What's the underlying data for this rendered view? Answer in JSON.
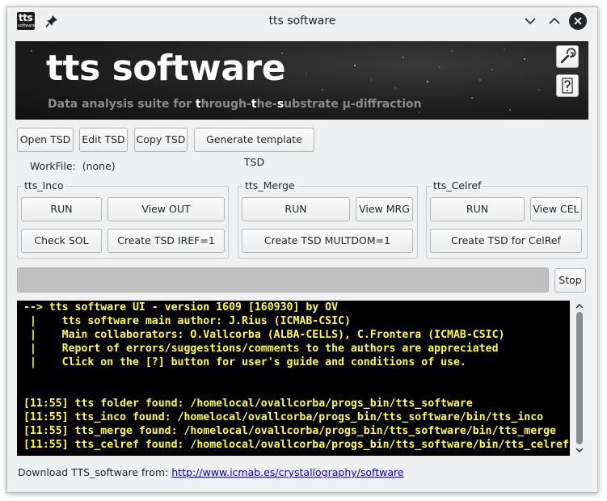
{
  "window": {
    "title": "tts software",
    "icon_text": "tts",
    "icon_subtext": "software"
  },
  "banner": {
    "title": "tts software",
    "subtitle_parts": [
      "Data analysis suite for ",
      "t",
      "hrough-",
      "t",
      "he-",
      "s",
      "ubstrate µ-diffraction"
    ]
  },
  "top_buttons": {
    "open": "Open TSD",
    "edit": "Edit TSD",
    "copy": "Copy TSD",
    "template": "Generate template TSD"
  },
  "workfile": {
    "label": "WorkFile:",
    "value": "(none)"
  },
  "inco": {
    "title": "tts_Inco",
    "run": "RUN",
    "view": "View OUT",
    "check": "Check SOL",
    "create": "Create TSD IREF=1"
  },
  "merge": {
    "title": "tts_Merge",
    "run": "RUN",
    "view": "View MRG",
    "create": "Create TSD MULTDOM=1"
  },
  "celref": {
    "title": "tts_Celref",
    "run": "RUN",
    "view": "View CEL",
    "create": "Create TSD for CelRef"
  },
  "stop_label": "Stop",
  "console": {
    "lines": [
      "--> tts software UI - version 1609 [160930] by OV",
      " |    tts software main author: J.Rius (ICMAB-CSIC)",
      " |    Main collaborators: O.Vallcorba (ALBA-CELLS), C.Frontera (ICMAB-CSIC)",
      " |    Report of errors/suggestions/comments to the authors are appreciated",
      " |    Click on the [?] button for user's guide and conditions of use.",
      "",
      "",
      "[11:55] tts folder found: /homelocal/ovallcorba/progs_bin/tts_software",
      "[11:55] tts_inco found: /homelocal/ovallcorba/progs_bin/tts_software/bin/tts_inco",
      "[11:55] tts_merge found: /homelocal/ovallcorba/progs_bin/tts_software/bin/tts_merge",
      "[11:55] tts_celref found: /homelocal/ovallcorba/progs_bin/tts_software/bin/tts_celref"
    ]
  },
  "footer": {
    "text": "Download TTS_software from:",
    "link": "http://www.icmab.es/crystallography/software"
  },
  "icons": [
    "app-logo-icon",
    "pin-icon",
    "minimize-icon",
    "maximize-icon",
    "close-icon",
    "wrench-icon",
    "help-icon",
    "scroll-up-icon",
    "scroll-down-icon"
  ],
  "colors": {
    "console_bg": "#000000",
    "console_text": "#ffff33",
    "window_bg": "#eff0f1",
    "link": "#0000ee"
  }
}
